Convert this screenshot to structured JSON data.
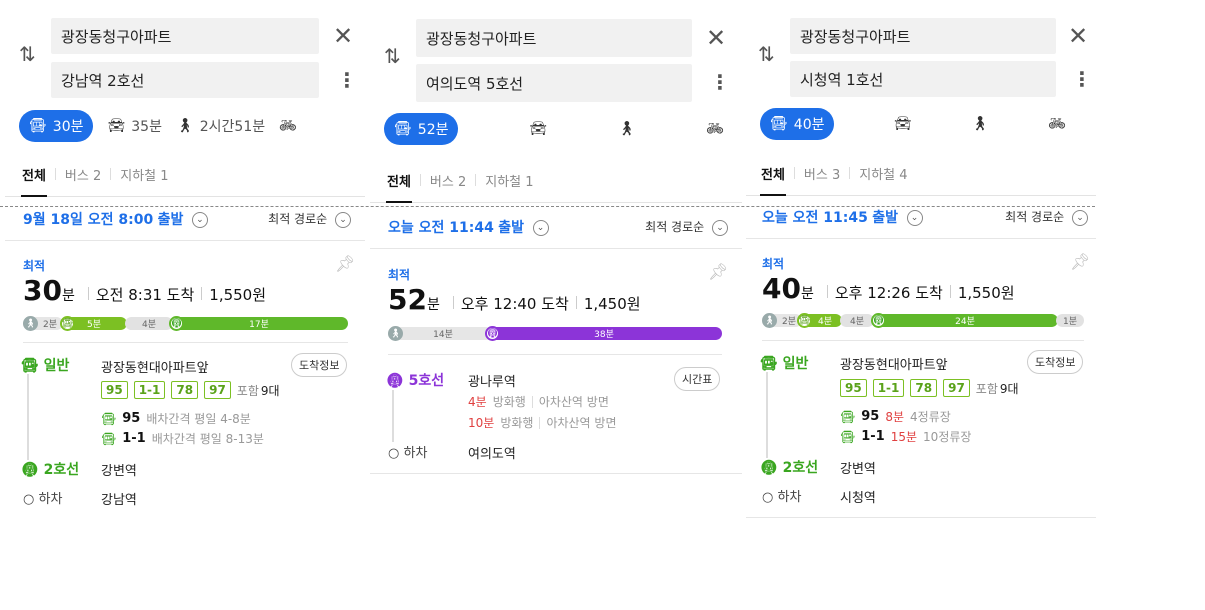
{
  "panels": [
    {
      "origin": "광장동청구아파트",
      "destination": "강남역 2호선",
      "modes": [
        {
          "icon": "bus-icon",
          "label": "30분",
          "active": true
        },
        {
          "icon": "car-icon",
          "label": "35분"
        },
        {
          "icon": "walk-icon",
          "label": "2시간51분"
        },
        {
          "icon": "bike-icon",
          "label": ""
        }
      ],
      "tabs": [
        "전체",
        "버스 2",
        "지하철 1"
      ],
      "departure": "9월 18일 오전 8:00",
      "departure_suffix": "출발",
      "sort": "최적 경로순",
      "best_label": "최적",
      "minutes": "30",
      "min_unit": "분",
      "arrival": "오전 8:31 도착",
      "fare": "1,550원",
      "bar": [
        {
          "type": "walk",
          "label": "2분"
        },
        {
          "type": "lime",
          "label": "5분"
        },
        {
          "type": "gray",
          "label": "4분"
        },
        {
          "type": "green",
          "label": "17분"
        }
      ],
      "legs": {
        "bus_label": "일반",
        "bus_stop": "광장동현대아파트앞",
        "chip": "도착정보",
        "routes": [
          "95",
          "1-1",
          "78",
          "97"
        ],
        "include": "포함",
        "include_count": "9대",
        "details": [
          {
            "num": "95",
            "text": "배차간격 평일 4-8분"
          },
          {
            "num": "1-1",
            "text": "배차간격 평일 8-13분"
          }
        ],
        "subway_label": "2호선",
        "subway_stop": "강변역",
        "exit_label": "하차",
        "exit_stop": "강남역"
      }
    },
    {
      "origin": "광장동청구아파트",
      "destination": "여의도역 5호선",
      "modes": [
        {
          "icon": "bus-icon",
          "label": "52분",
          "active": true
        },
        {
          "icon": "car-icon",
          "label": ""
        },
        {
          "icon": "walk-icon",
          "label": ""
        },
        {
          "icon": "bike-icon",
          "label": ""
        }
      ],
      "tabs": [
        "전체",
        "버스 2",
        "지하철 1"
      ],
      "departure": "오늘 오전 11:44",
      "departure_suffix": "출발",
      "sort": "최적 경로순",
      "best_label": "최적",
      "minutes": "52",
      "min_unit": "분",
      "arrival": "오후 12:40 도착",
      "fare": "1,450원",
      "bar": [
        {
          "type": "walk",
          "label": "14분"
        },
        {
          "type": "purple",
          "label": "38분"
        }
      ],
      "legs": {
        "subway_label": "5호선",
        "subway_stop": "광나루역",
        "chip": "시간표",
        "times": [
          {
            "min": "4분",
            "dir": "방화행",
            "dir2": "아차산역 방면"
          },
          {
            "min": "10분",
            "dir": "방화행",
            "dir2": "아차산역 방면"
          }
        ],
        "exit_label": "하차",
        "exit_stop": "여의도역"
      }
    },
    {
      "origin": "광장동청구아파트",
      "destination": "시청역 1호선",
      "modes": [
        {
          "icon": "bus-icon",
          "label": "40분",
          "active": true
        },
        {
          "icon": "car-icon",
          "label": ""
        },
        {
          "icon": "walk-icon",
          "label": ""
        },
        {
          "icon": "bike-icon",
          "label": ""
        }
      ],
      "tabs": [
        "전체",
        "버스 3",
        "지하철 4"
      ],
      "departure": "오늘 오전 11:45",
      "departure_suffix": "출발",
      "sort": "최적 경로순",
      "best_label": "최적",
      "minutes": "40",
      "min_unit": "분",
      "arrival": "오후 12:26 도착",
      "fare": "1,550원",
      "bar": [
        {
          "type": "walk",
          "label": "2분"
        },
        {
          "type": "lime",
          "label": "4분"
        },
        {
          "type": "gray",
          "label": "4분"
        },
        {
          "type": "green",
          "label": "24분"
        },
        {
          "type": "gray",
          "label": "1분"
        }
      ],
      "legs": {
        "bus_label": "일반",
        "bus_stop": "광장동현대아파트앞",
        "chip": "도착정보",
        "routes": [
          "95",
          "1-1",
          "78",
          "97"
        ],
        "include": "포함",
        "include_count": "9대",
        "details": [
          {
            "num": "95",
            "min": "8분",
            "text": "4정류장"
          },
          {
            "num": "1-1",
            "min": "15분",
            "text": "10정류장"
          }
        ],
        "subway_label": "2호선",
        "subway_stop": "강변역",
        "exit_label": "하차",
        "exit_stop": "시청역"
      }
    }
  ]
}
